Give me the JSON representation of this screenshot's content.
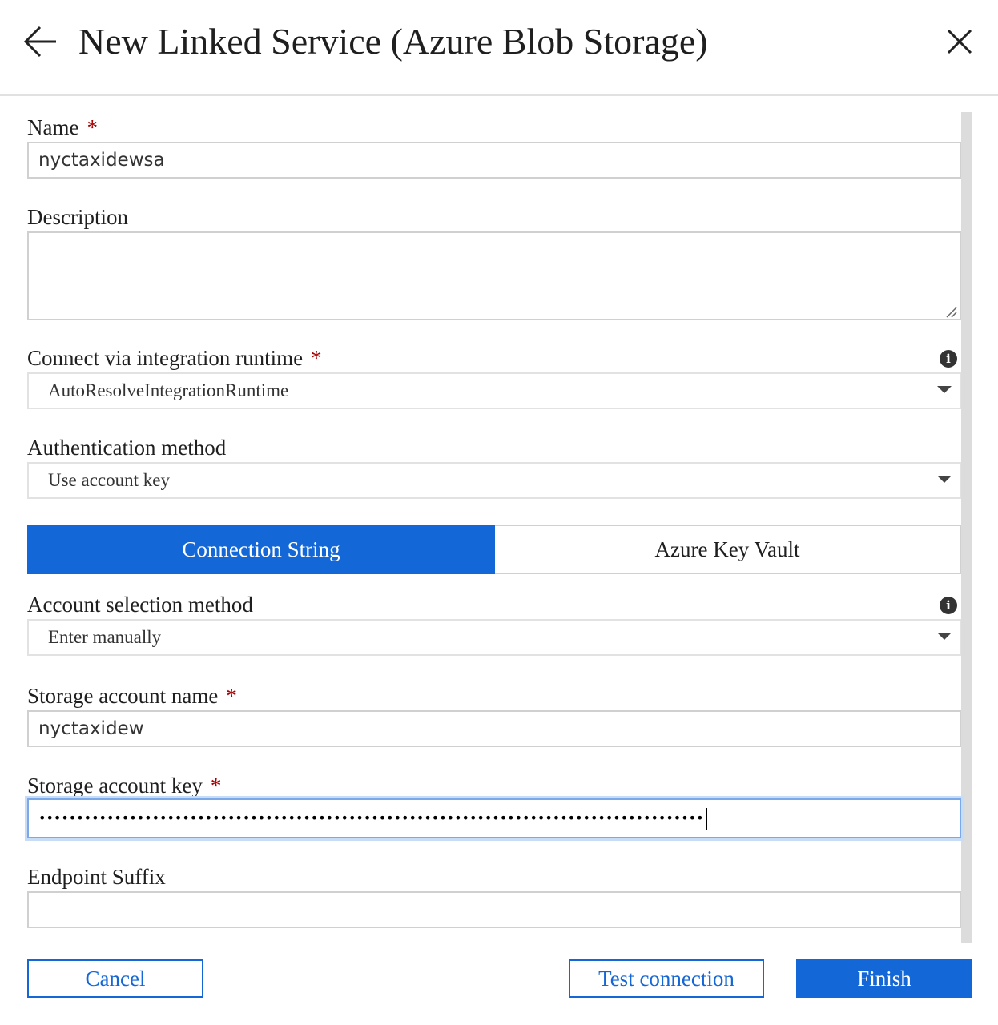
{
  "header": {
    "title": "New Linked Service (Azure Blob Storage)",
    "back_icon": "arrow-left-icon",
    "close_icon": "close-icon"
  },
  "form": {
    "name": {
      "label": "Name",
      "required_mark": "*",
      "value": "nyctaxidewsa"
    },
    "description": {
      "label": "Description",
      "value": ""
    },
    "integration_runtime": {
      "label": "Connect via integration runtime",
      "required_mark": "*",
      "value": "AutoResolveIntegrationRuntime",
      "info_icon": "info-icon"
    },
    "auth_method": {
      "label": "Authentication method",
      "value": "Use account key"
    },
    "tabs": {
      "connection_string": "Connection String",
      "key_vault": "Azure Key Vault",
      "active": "Connection String"
    },
    "account_selection": {
      "label": "Account selection method",
      "value": "Enter manually",
      "info_icon": "info-icon"
    },
    "storage_account_name": {
      "label": "Storage account name",
      "required_mark": "*",
      "value": "nyctaxidew"
    },
    "storage_account_key": {
      "label": "Storage account key",
      "required_mark": "*",
      "masked_value": "••••••••••••••••••••••••••••••••••••••••••••••••••••••••••••••••••••••••••••••••••••••••"
    },
    "endpoint_suffix": {
      "label": "Endpoint Suffix",
      "value": ""
    }
  },
  "footer": {
    "cancel": "Cancel",
    "test_connection": "Test connection",
    "finish": "Finish"
  },
  "colors": {
    "accent": "#1467d6",
    "required": "#a80000"
  }
}
